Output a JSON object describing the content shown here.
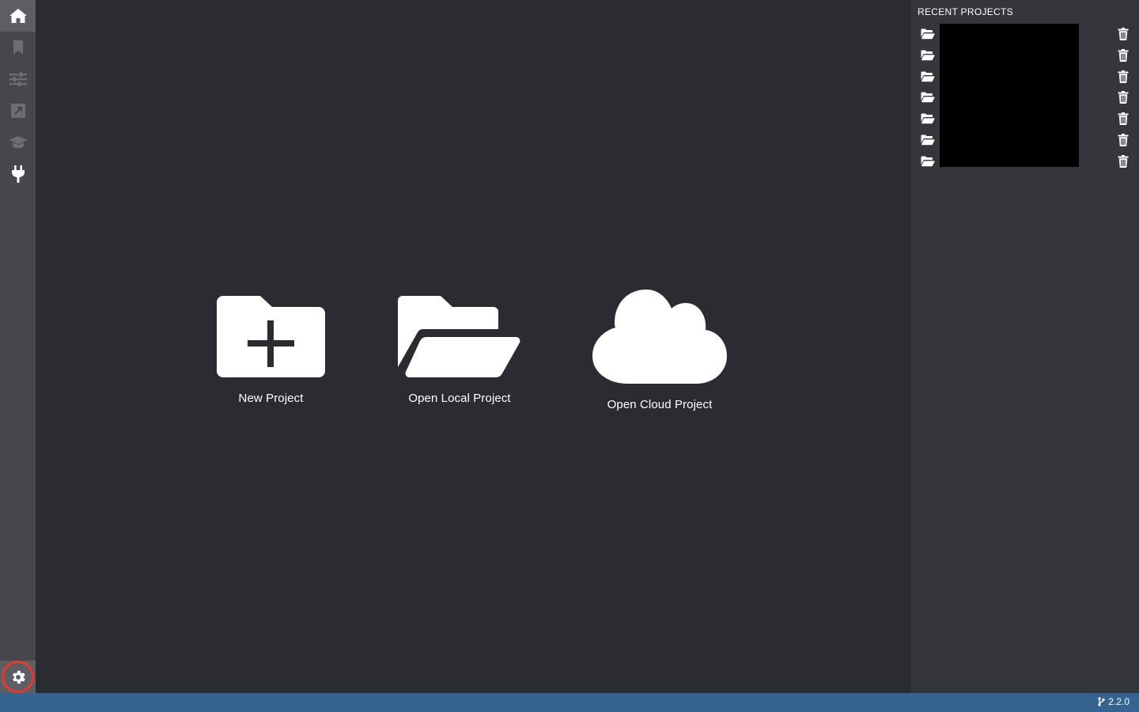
{
  "activity_bar": {
    "items": [
      {
        "icon": "home-icon",
        "active": true
      },
      {
        "icon": "bookmark-icon",
        "active": false
      },
      {
        "icon": "sliders-icon",
        "active": false
      },
      {
        "icon": "external-edit-icon",
        "active": false
      },
      {
        "icon": "graduation-cap-icon",
        "active": false
      },
      {
        "icon": "plug-icon",
        "active": false
      }
    ],
    "settings_icon": "gear-icon"
  },
  "main": {
    "actions": [
      {
        "label": "New Project",
        "icon": "folder-plus-icon"
      },
      {
        "label": "Open Local Project",
        "icon": "folder-open-icon"
      },
      {
        "label": "Open Cloud Project",
        "icon": "cloud-icon"
      }
    ]
  },
  "recent": {
    "title": "RECENT PROJECTS",
    "count": 7,
    "row_icon": "folder-open-icon",
    "delete_icon": "trash-icon"
  },
  "status_bar": {
    "version": "2.2.0",
    "branch_icon": "git-branch-icon"
  },
  "colors": {
    "background": "#2a2c31",
    "activity_bar": "#45474d",
    "panel": "#34363c",
    "status_bar": "#34648f",
    "highlight_ring": "#e8382c"
  }
}
